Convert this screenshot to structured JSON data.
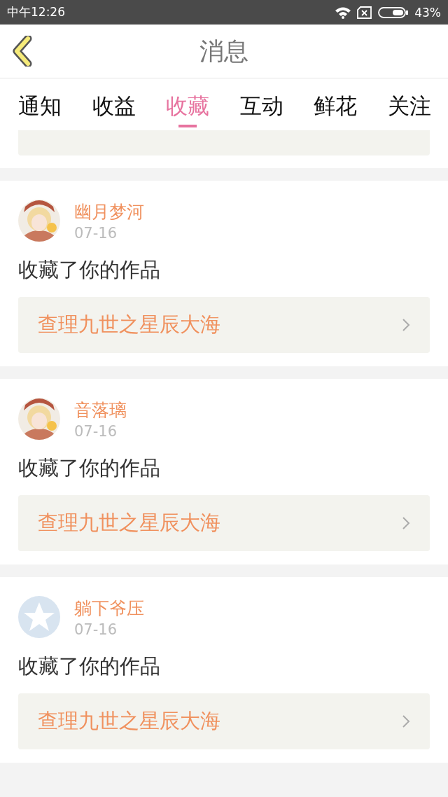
{
  "status_bar": {
    "time": "中午12:26",
    "battery": "43%"
  },
  "header": {
    "title": "消息"
  },
  "tabs": [
    {
      "label": "通知",
      "selected": false
    },
    {
      "label": "收益",
      "selected": false
    },
    {
      "label": "收藏",
      "selected": true
    },
    {
      "label": "互动",
      "selected": false
    },
    {
      "label": "鲜花",
      "selected": false
    },
    {
      "label": "关注",
      "selected": false
    }
  ],
  "messages": [
    {
      "name": "幽月梦河",
      "date": "07-16",
      "text": "收藏了你的作品",
      "work": "查理九世之星辰大海"
    },
    {
      "name": "音落璃",
      "date": "07-16",
      "text": "收藏了你的作品",
      "work": "查理九世之星辰大海"
    },
    {
      "avatar": {
        "kind": "default"
      },
      "name": "躺下爷压",
      "date": "07-16",
      "text": "收藏了你的作品",
      "work": "查理九世之星辰大海"
    }
  ]
}
